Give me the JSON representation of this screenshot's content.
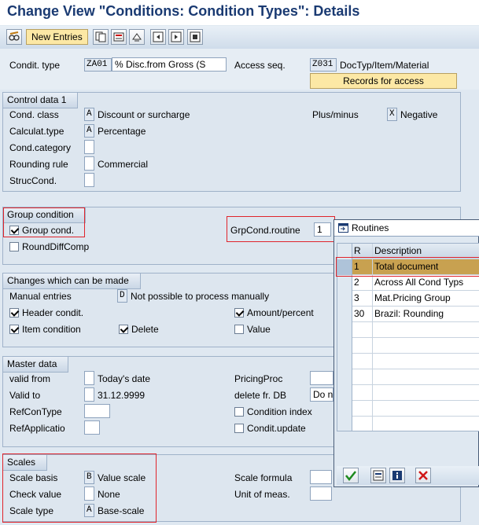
{
  "title": "Change View \"Conditions: Condition Types\": Details",
  "toolbar": {
    "new_entries": "New Entries"
  },
  "header": {
    "condit_type_label": "Condit. type",
    "condit_type_code": "ZA01",
    "condit_type_desc": "% Disc.from Gross (S",
    "access_seq_label": "Access seq.",
    "access_seq_code": "Z031",
    "access_seq_desc": "DocTyp/Item/Material",
    "records_button": "Records for access"
  },
  "control_data": {
    "title": "Control data 1",
    "cond_class_label": "Cond. class",
    "cond_class_code": "A",
    "cond_class_desc": "Discount or surcharge",
    "plus_minus_label": "Plus/minus",
    "plus_minus_code": "X",
    "plus_minus_desc": "Negative",
    "calc_type_label": "Calculat.type",
    "calc_type_code": "A",
    "calc_type_desc": "Percentage",
    "cond_category_label": "Cond.category",
    "rounding_label": "Rounding rule",
    "rounding_desc": "Commercial",
    "struc_label": "StrucCond."
  },
  "group_condition": {
    "title": "Group condition",
    "group_cond_label": "Group cond.",
    "group_cond_checked": true,
    "round_diff_label": "RoundDiffComp",
    "round_diff_checked": false,
    "routine_label": "GrpCond.routine",
    "routine_value": "1"
  },
  "changes": {
    "title": "Changes which can be made",
    "manual_label": "Manual entries",
    "manual_code": "D",
    "manual_desc": "Not possible to process manually",
    "header_label": "Header condit.",
    "header_checked": true,
    "amount_label": "Amount/percent",
    "amount_checked": true,
    "item_label": "Item condition",
    "item_checked": true,
    "delete_label": "Delete",
    "delete_checked": true,
    "value_label": "Value",
    "value_checked": false
  },
  "master": {
    "title": "Master data",
    "valid_from_label": "valid from",
    "valid_from_desc": "Today's date",
    "pricing_label": "PricingProc",
    "valid_to_label": "Valid to",
    "valid_to_desc": "31.12.9999",
    "delete_db_label": "delete fr. DB",
    "delete_db_value": "Do n",
    "refcon_label": "RefConType",
    "cond_index_label": "Condition index",
    "refapp_label": "RefApplicatio",
    "cond_update_label": "Condit.update"
  },
  "scales": {
    "title": "Scales",
    "scale_basis_label": "Scale basis",
    "scale_basis_code": "B",
    "scale_basis_desc": "Value scale",
    "scale_formula_label": "Scale formula",
    "check_label": "Check value",
    "check_desc": "None",
    "unit_label": "Unit of meas.",
    "scale_type_label": "Scale type",
    "scale_type_code": "A",
    "scale_type_desc": "Base-scale"
  },
  "popup": {
    "title": "Routines",
    "col_r": "R",
    "col_desc": "Description",
    "rows": [
      {
        "r": "1",
        "desc": "Total document"
      },
      {
        "r": "2",
        "desc": "Across All Cond Typs"
      },
      {
        "r": "3",
        "desc": "Mat.Pricing Group"
      },
      {
        "r": "30",
        "desc": "Brazil: Rounding"
      }
    ]
  },
  "colors": {
    "title": "#1a3a72",
    "highlight_red": "#e0242b",
    "selected_row": "#c8a150",
    "button_yellow": "#fce8a5"
  }
}
